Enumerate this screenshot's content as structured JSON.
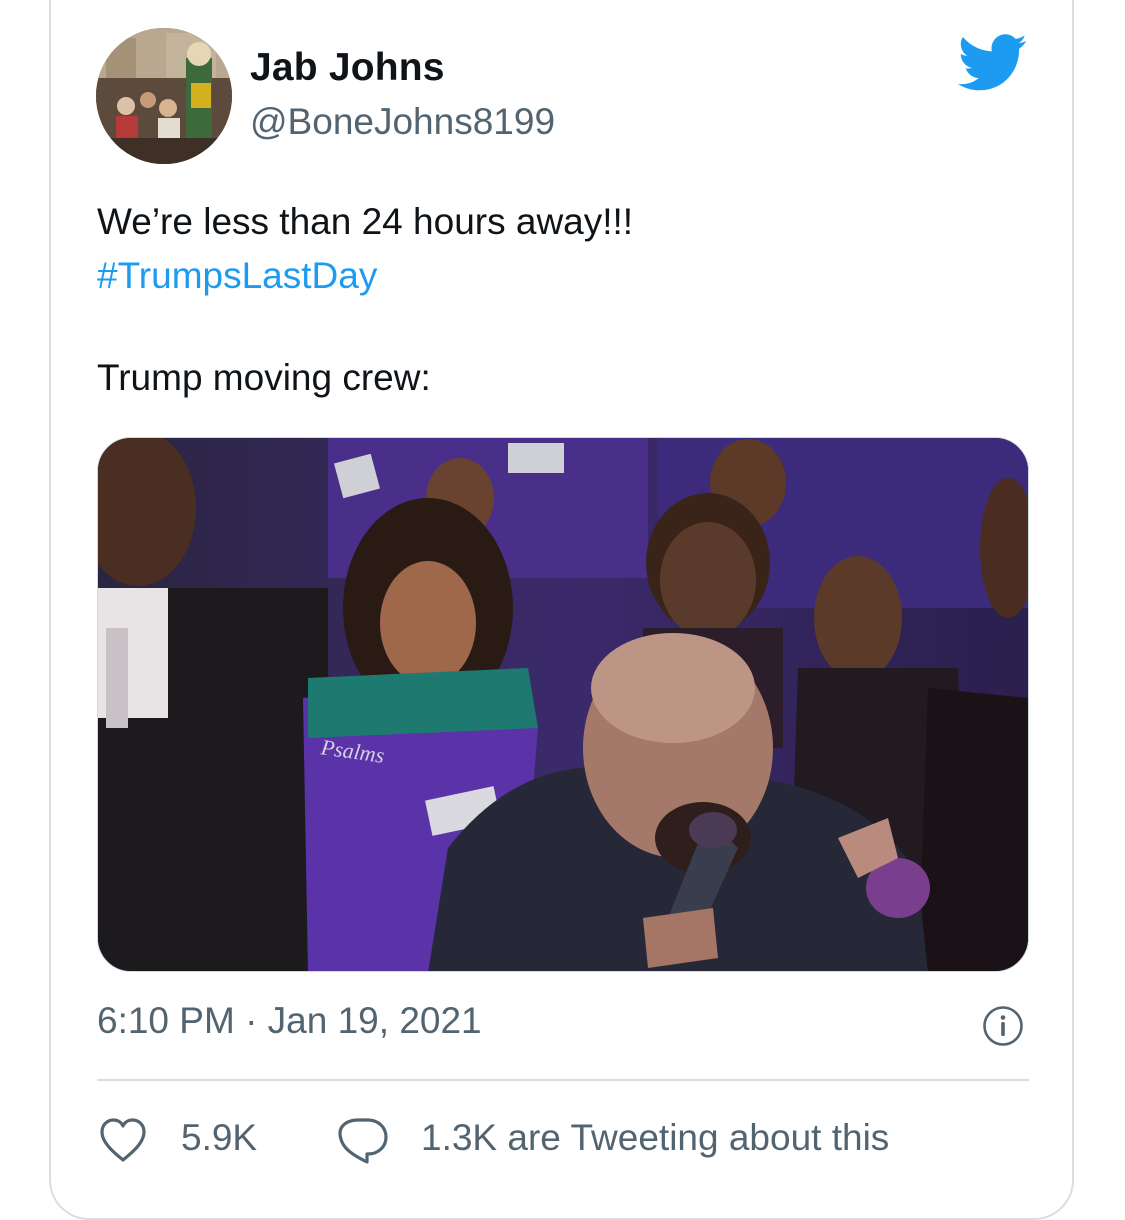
{
  "user": {
    "display_name": "Jab Johns",
    "handle": "@BoneJohns8199"
  },
  "tweet": {
    "text_line1": "We’re less than 24 hours away!!!",
    "hashtag": "#TrumpsLastDay",
    "text_line2": "Trump moving crew:"
  },
  "meta": {
    "timestamp": "6:10 PM · Jan 19, 2021"
  },
  "actions": {
    "likes": "5.9K",
    "tweeting": "1.3K are Tweeting about this"
  },
  "icons": {
    "brand": "twitter-bird-icon",
    "info": "info-icon",
    "like": "heart-icon",
    "reply": "speech-bubble-icon"
  },
  "colors": {
    "brand_blue": "#1d9bf0",
    "secondary_text": "#536471",
    "primary_text": "#0f1419"
  },
  "media": {
    "sweater_text": "Psalms"
  }
}
